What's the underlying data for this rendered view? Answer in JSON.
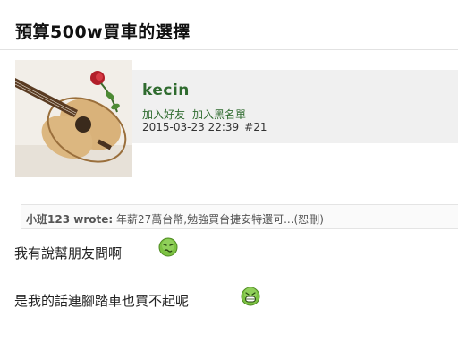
{
  "thread": {
    "title": "預算500w買車的選擇"
  },
  "post": {
    "author": "kecin",
    "add_friend": "加入好友",
    "add_blacklist": "加入黑名單",
    "timestamp": "2015-03-23 22:39",
    "floor": "#21",
    "quote": {
      "author": "小班123 wrote:",
      "text": "年薪27萬台幣,勉強買台捷安特還可...(恕刪)"
    },
    "lines": [
      {
        "text": "我有說幫朋友問啊",
        "emoji": "sick-face-icon"
      },
      {
        "text": "是我的話連腳踏車也買不起呢",
        "emoji": "grin-face-icon"
      }
    ]
  },
  "colors": {
    "username": "#2f6b2f",
    "emoji_green": "#7cc242"
  }
}
